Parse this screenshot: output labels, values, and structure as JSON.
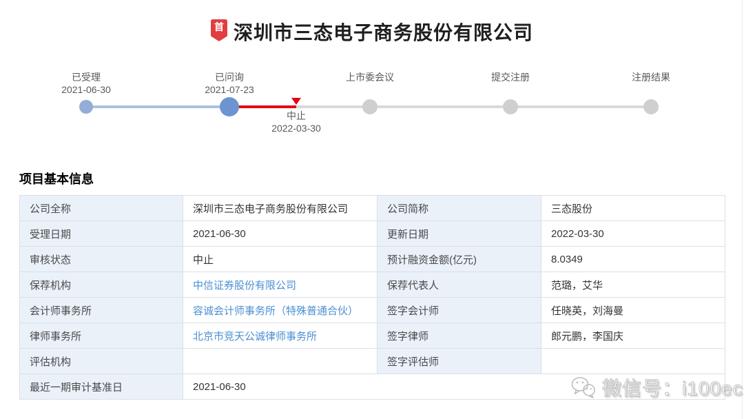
{
  "header": {
    "badge": "首",
    "title": "深圳市三态电子商务股份有限公司"
  },
  "timeline": {
    "steps": [
      {
        "label": "已受理",
        "date": "2021-06-30",
        "state": "done"
      },
      {
        "label": "已问询",
        "date": "2021-07-23",
        "state": "current"
      },
      {
        "label": "上市委会议",
        "date": "",
        "state": "pending"
      },
      {
        "label": "提交注册",
        "date": "",
        "state": "pending"
      },
      {
        "label": "注册结果",
        "date": "",
        "state": "pending"
      }
    ],
    "interrupt": {
      "label": "中止",
      "date": "2022-03-30"
    },
    "colors": {
      "done_dot": "#92add6",
      "current_dot": "#6b94d1",
      "pending_dot": "#cfcfcf",
      "done_line": "#aac1e0",
      "pending_line": "#d9d9d9",
      "interrupt_red": "#e60012"
    }
  },
  "section": {
    "title": "项目基本信息"
  },
  "table": {
    "label_bg": "#eaf1f9",
    "link_color": "#4a8fd3",
    "rows": [
      {
        "l1": "公司全称",
        "v1": "深圳市三态电子商务股份有限公司",
        "l2": "公司简称",
        "v2": "三态股份"
      },
      {
        "l1": "受理日期",
        "v1": "2021-06-30",
        "l2": "更新日期",
        "v2": "2022-03-30"
      },
      {
        "l1": "审核状态",
        "v1": "中止",
        "l2": "预计融资金额(亿元)",
        "v2": "8.0349"
      },
      {
        "l1": "保荐机构",
        "v1": "中信证券股份有限公司",
        "l2": "保荐代表人",
        "v2": "范璐，艾华"
      },
      {
        "l1": "会计师事务所",
        "v1": "容诚会计师事务所（特殊普通合伙）",
        "l2": "签字会计师",
        "v2": "任晓英，刘海曼"
      },
      {
        "l1": "律师事务所",
        "v1": "北京市竞天公诚律师事务所",
        "l2": "签字律师",
        "v2": "郎元鹏，李国庆"
      },
      {
        "l1": "评估机构",
        "v1": "",
        "l2": "签字评估师",
        "v2": ""
      },
      {
        "l1": "最近一期审计基准日",
        "v1": "2021-06-30"
      }
    ]
  },
  "watermark": {
    "icon": "wechat-icon",
    "text": "微信号：i100ec"
  }
}
